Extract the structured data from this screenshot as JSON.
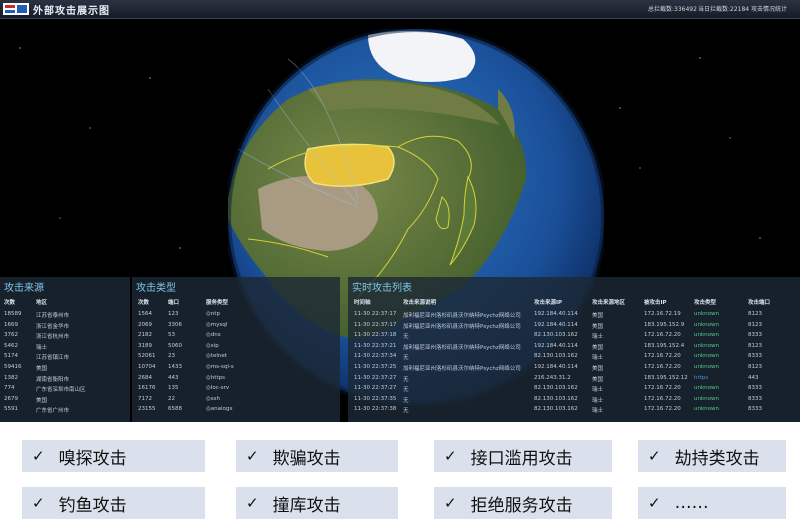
{
  "header": {
    "title": "外部攻击展示图",
    "total_blocked": "总拦截数:336492",
    "today_blocked": "当日拦截数:22184",
    "stats_link": "攻击情况统计"
  },
  "source_panel": {
    "title": "攻击来源",
    "columns": [
      "次数",
      "地区"
    ],
    "rows": [
      [
        "18589",
        "江苏省泰州市"
      ],
      [
        "1669",
        "浙江省金华市"
      ],
      [
        "3762",
        "浙江省杭州市"
      ],
      [
        "5462",
        "瑞士"
      ],
      [
        "5174",
        "江苏省镇江市"
      ],
      [
        "59416",
        "美国"
      ],
      [
        "1382",
        "湖南省衡阳市"
      ],
      [
        "774",
        "广东省深圳市南山区"
      ],
      [
        "2679",
        "美国"
      ],
      [
        "5591",
        "广东省广州市"
      ]
    ]
  },
  "type_panel": {
    "title": "攻击类型",
    "columns": [
      "次数",
      "端口",
      "服务类型"
    ],
    "rows": [
      [
        "1564",
        "123",
        "ntp"
      ],
      [
        "2069",
        "3306",
        "mysql"
      ],
      [
        "2182",
        "53",
        "dns"
      ],
      [
        "3189",
        "5060",
        "sip"
      ],
      [
        "52061",
        "23",
        "telnet"
      ],
      [
        "10704",
        "1433",
        "ms-sql-s"
      ],
      [
        "2684",
        "443",
        "https"
      ],
      [
        "16176",
        "135",
        "loc-srv"
      ],
      [
        "7172",
        "22",
        "ssh"
      ],
      [
        "23155",
        "6588",
        "analogx"
      ]
    ]
  },
  "realtime_panel": {
    "title": "实时攻击列表",
    "columns": [
      "时间轴",
      "攻击来源说明",
      "攻击来源IP",
      "攻击来源地区",
      "被攻击IP",
      "攻击类型",
      "攻击端口"
    ],
    "rows": [
      [
        "11-30 22:37:17",
        "加利福尼亚州洛杉矶县沃尔纳特Psychz网络公司",
        "192.184.40.114",
        "美国",
        "172.16.72.19",
        "unknown",
        "8123"
      ],
      [
        "11-30 22:37:17",
        "加利福尼亚州洛杉矶县沃尔纳特Psychz网络公司",
        "192.184.40.114",
        "美国",
        "183.195.152.9",
        "unknown",
        "8123"
      ],
      [
        "11-30 22:37:18",
        "无",
        "82.130.103.162",
        "瑞士",
        "172.16.72.20",
        "unknown",
        "8333"
      ],
      [
        "11-30 22:37:21",
        "加利福尼亚州洛杉矶县沃尔纳特Psychz网络公司",
        "192.184.40.114",
        "美国",
        "183.195.152.4",
        "unknown",
        "8123"
      ],
      [
        "11-30 22:37:34",
        "无",
        "82.130.103.162",
        "瑞士",
        "172.16.72.20",
        "unknown",
        "8333"
      ],
      [
        "11-30 22:37:25",
        "加利福尼亚州洛杉矶县沃尔纳特Psychz网络公司",
        "192.184.40.114",
        "美国",
        "172.16.72.20",
        "unknown",
        "8123"
      ],
      [
        "11-30 22:37:27",
        "无",
        "216.243.31.2",
        "美国",
        "183.195.152.12",
        "https",
        "443"
      ],
      [
        "11-30 22:37:27",
        "无",
        "82.130.103.162",
        "瑞士",
        "172.16.72.20",
        "unknown",
        "8333"
      ],
      [
        "11-30 22:37:35",
        "无",
        "82.130.103.162",
        "瑞士",
        "172.16.72.20",
        "unknown",
        "8333"
      ],
      [
        "11-30 22:37:38",
        "无",
        "82.130.103.162",
        "瑞士",
        "172.16.72.20",
        "unknown",
        "8333"
      ]
    ]
  },
  "attack_tags": [
    "嗅探攻击",
    "欺骗攻击",
    "接口滥用攻击",
    "劫持类攻击",
    "钓鱼攻击",
    "撞库攻击",
    "拒绝服务攻击",
    "……"
  ],
  "check_symbol": "✓",
  "colors": {
    "ocean": "#1e5aa8",
    "highlight_country": "#e8c23a",
    "panel_title": "#7fc6e8",
    "unknown_type": "#4fd08a",
    "https_type": "#4a90e2",
    "tag_background": "#dbe1ec"
  }
}
